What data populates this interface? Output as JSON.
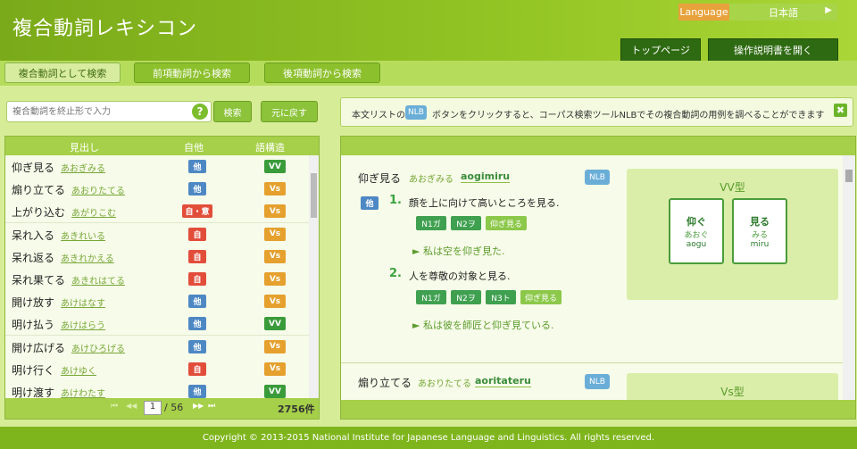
{
  "app": {
    "title": "複合動詞レキシコン"
  },
  "language": {
    "label": "Language",
    "value": "日本語",
    "arrow": "▶"
  },
  "header_buttons": {
    "top": "トップページ",
    "manual": "操作説明書を開く"
  },
  "tabs": [
    "複合動詞として検索",
    "前項動詞から検索",
    "後項動詞から検索"
  ],
  "search": {
    "placeholder": "複合動詞を終止形で入力",
    "help": "?",
    "search_label": "検索",
    "reset_label": "元に戻す"
  },
  "list": {
    "headers": [
      "見出し",
      "自他",
      "語構造"
    ],
    "rows": [
      {
        "word": "仰ぎ見る",
        "kana": "あおぎみる",
        "jita": "他",
        "struct": "VV"
      },
      {
        "word": "煽り立てる",
        "kana": "あおりたてる",
        "jita": "他",
        "struct": "Vs"
      },
      {
        "word": "上がり込む",
        "kana": "あがりこむ",
        "jita": "自・意",
        "struct": "Vs"
      },
      {
        "word": "呆れ入る",
        "kana": "あきれいる",
        "jita": "自",
        "struct": "Vs"
      },
      {
        "word": "呆れ返る",
        "kana": "あきれかえる",
        "jita": "自",
        "struct": "Vs"
      },
      {
        "word": "呆れ果てる",
        "kana": "あきれはてる",
        "jita": "自",
        "struct": "Vs"
      },
      {
        "word": "開け放す",
        "kana": "あけはなす",
        "jita": "他",
        "struct": "Vs"
      },
      {
        "word": "明け払う",
        "kana": "あけはらう",
        "jita": "他",
        "struct": "VV"
      },
      {
        "word": "開け広げる",
        "kana": "あけひろげる",
        "jita": "他",
        "struct": "Vs"
      },
      {
        "word": "明け行く",
        "kana": "あけゆく",
        "jita": "自",
        "struct": "Vs"
      },
      {
        "word": "明け渡す",
        "kana": "あけわたす",
        "jita": "他",
        "struct": "VV"
      }
    ],
    "pager": {
      "first": "⏮",
      "prev": "◀◀",
      "page": "1",
      "total": "/ 56",
      "next": "▶▶",
      "last": "⏭",
      "count": "2756件"
    }
  },
  "notice": {
    "pre": "本文リストの",
    "nlb": "NLB",
    "post": "ボタンをクリックすると、コーパス検索ツールNLBでその複合動詞の用例を調べることができます",
    "close": "✖"
  },
  "entry1": {
    "word": "仰ぎ見る",
    "kana": "あおぎみる",
    "romaji": "aogimiru",
    "nlb": "NLB",
    "jita": "他",
    "senses": [
      {
        "num": "1.",
        "def": "顔を上に向けて高いところを見る.",
        "args": [
          "N1ガ",
          "N2ヲ",
          "仰ぎ見る"
        ],
        "example": "► 私は空を仰ぎ見た."
      },
      {
        "num": "2.",
        "def": "人を尊敬の対象と見る.",
        "args": [
          "N1ガ",
          "N2ヲ",
          "N3ト",
          "仰ぎ見る"
        ],
        "example": "► 私は彼を師匠と仰ぎ見ている."
      }
    ],
    "type_title": "VV型",
    "components": [
      {
        "kanji": "仰ぐ",
        "kana": "あおぐ",
        "romaji": "aogu"
      },
      {
        "kanji": "見る",
        "kana": "みる",
        "romaji": "miru"
      }
    ]
  },
  "entry2": {
    "word": "煽り立てる",
    "kana": "あおりたてる",
    "romaji": "aoritateru",
    "nlb": "NLB",
    "type_title": "Vs型"
  },
  "footer": {
    "copyright": "Copyright © 2013-2015 National Institute for Japanese Language and Linguistics. All rights reserved."
  },
  "colors": {
    "header": "#8cc02c",
    "badge_ta": "#4e88c4",
    "badge_ji": "#e24d3a",
    "badge_vv": "#3a9b3a",
    "badge_vs": "#e5a02d"
  }
}
